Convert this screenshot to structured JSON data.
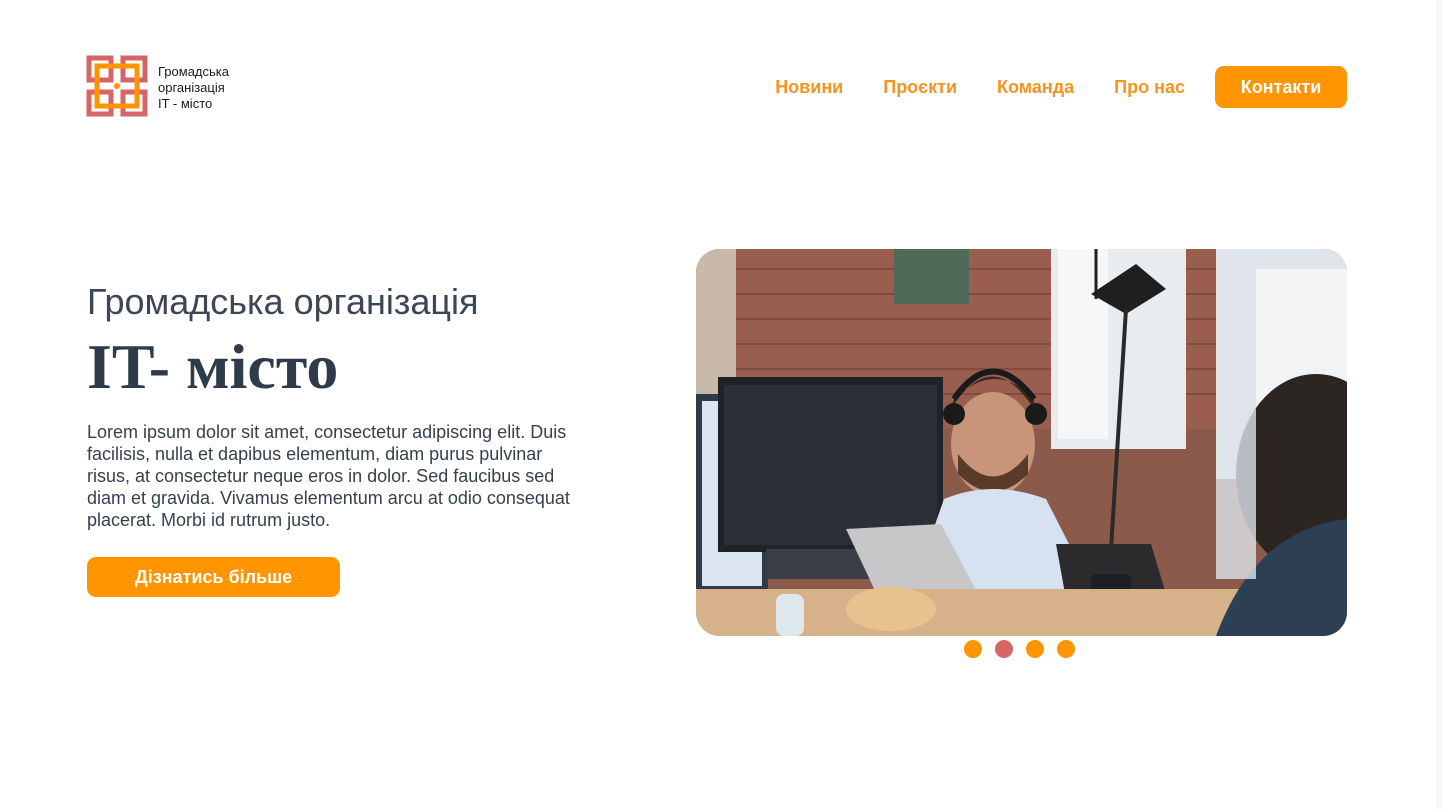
{
  "header": {
    "logo_lines": [
      "Громадська",
      "організація",
      "IT - місто"
    ],
    "nav": [
      "Новини",
      "Проєкти",
      "Команда",
      "Про нас"
    ],
    "cta": "Контакти"
  },
  "hero": {
    "subtitle": "Громадська організація",
    "title": "IT- місто",
    "text": "Lorem ipsum dolor sit amet, consectetur adipiscing elit. Duis facilisis, nulla et dapibus elementum, diam purus pulvinar risus, at consectetur neque eros in dolor. Sed faucibus sed diam et gravida. Vivamus elementum arcu at odio consequat placerat. Morbi id rutrum justo.",
    "button": "Дізнатись більше"
  },
  "slider": {
    "dots_count": 4,
    "active_index": 1,
    "image": "office-worker-with-headset-photo"
  },
  "colors": {
    "accent": "#ff9500",
    "nav_text": "#f7931e",
    "active_dot": "#d66566",
    "logo_red": "#d66566",
    "heading": "#2f3b4a"
  }
}
